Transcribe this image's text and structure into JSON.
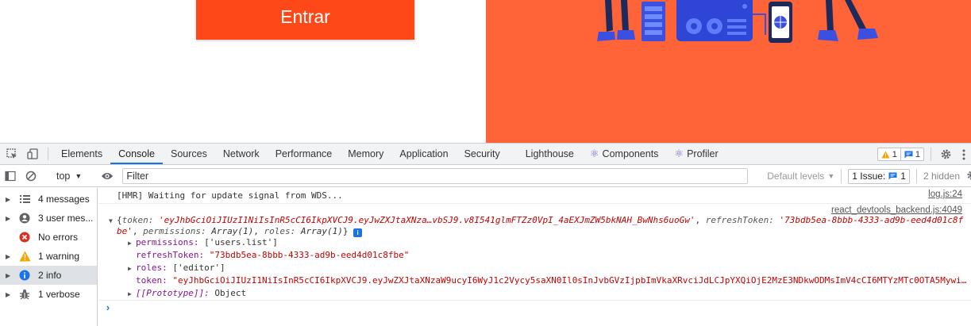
{
  "page": {
    "login_button_label": "Entrar",
    "brand_color": "#ff4817",
    "hero_color": "#ff6439"
  },
  "devtools": {
    "tabs": [
      {
        "label": "Elements"
      },
      {
        "label": "Console"
      },
      {
        "label": "Sources"
      },
      {
        "label": "Network"
      },
      {
        "label": "Performance"
      },
      {
        "label": "Memory"
      },
      {
        "label": "Application"
      },
      {
        "label": "Security"
      },
      {
        "label": "Lighthouse"
      },
      {
        "label": "Components"
      },
      {
        "label": "Profiler"
      }
    ],
    "active_tab": "Console",
    "warning_count": "1",
    "message_count": "1",
    "toolbar": {
      "context": "top",
      "filter_placeholder": "Filter",
      "levels_label": "Default levels",
      "issue_label": "1 Issue:",
      "issue_count": "1",
      "hidden_label": "2 hidden"
    },
    "sidebar": [
      {
        "label": "4 messages",
        "icon": "list-icon"
      },
      {
        "label": "3 user mes...",
        "icon": "user-icon"
      },
      {
        "label": "No errors",
        "icon": "error-icon"
      },
      {
        "label": "1 warning",
        "icon": "warning-icon"
      },
      {
        "label": "2 info",
        "icon": "info-icon"
      },
      {
        "label": "1 verbose",
        "icon": "bug-icon"
      }
    ],
    "console": {
      "hmr_message": "[HMR] Waiting for update signal from WDS...",
      "hmr_source": "log.js:24",
      "obj_source": "react_devtools_backend.js:4049",
      "summary": {
        "token_key": "token:",
        "token_val": "'eyJhbGciOiJIUzI1NiIsInR5cCI6IkpXVCJ9.eyJwZXJtaXNza…vbSJ9.v8I541glmFTZz0VpI_4aEXJmZW5bkNAH_BwNhs6uoGw'",
        "refresh_key": "refreshToken:",
        "refresh_val": "'73bdb5ea-8bbb-4333-ad9b-eed4d01c8fbe'",
        "permissions_key": "permissions:",
        "permissions_val": "Array(1)",
        "roles_key": "roles:",
        "roles_val": "Array(1)"
      },
      "props": {
        "permissions_key": "permissions:",
        "permissions_val": "['users.list']",
        "refresh_key": "refreshToken:",
        "refresh_val": "\"73bdb5ea-8bbb-4333-ad9b-eed4d01c8fbe\"",
        "roles_key": "roles:",
        "roles_val": "['editor']",
        "token_key": "token:",
        "token_val": "\"eyJhbGciOiJIUzI1NiIsInR5cCI6IkpXVCJ9.eyJwZXJtaXNzaW9ucyI6WyJ1c2Vycy5saXN0Il0sInJvbGVzIjpbImVkaXRvciJdLCJpYXQiOjE2MzE3NDkwODMsImV4cCI6MTYzMTc0OTA5Mywi…\"",
        "proto_key": "[[Prototype]]:",
        "proto_val": "Object"
      }
    }
  }
}
